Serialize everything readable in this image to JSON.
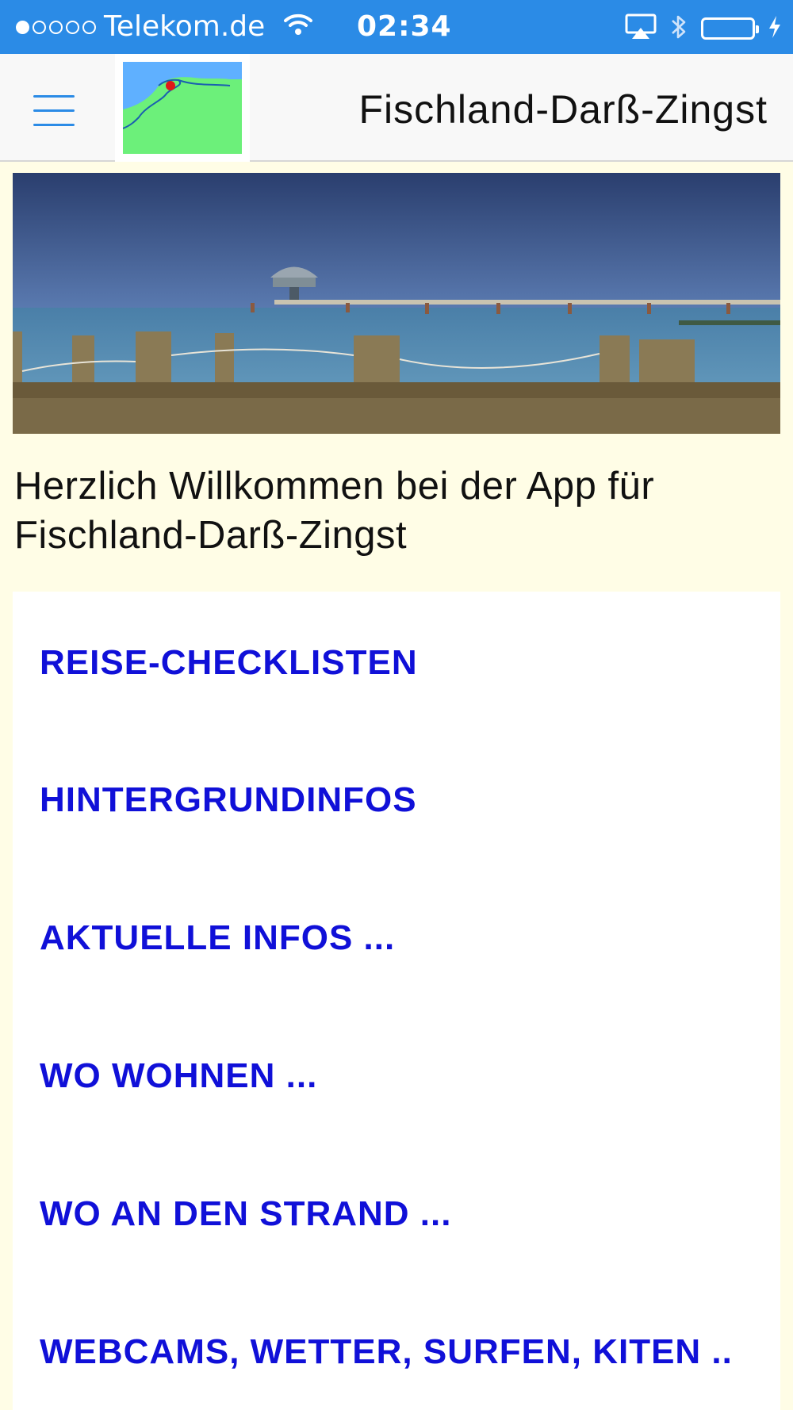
{
  "status_bar": {
    "carrier": "Telekom.de",
    "time": "02:34",
    "signal_bars_on": 1,
    "signal_bars_total": 5,
    "icons": [
      "wifi-icon",
      "airplay-icon",
      "bluetooth-icon",
      "battery-icon",
      "charging-icon"
    ]
  },
  "nav": {
    "title": "Fischland-Darß-Zingst",
    "menu_icon": "hamburger-icon",
    "logo_icon": "map-logo-icon"
  },
  "welcome": {
    "text": "Herzlich Willkommen bei der App für Fischland-Darß-Zingst"
  },
  "menu": {
    "items": [
      {
        "label": "REISE-CHECKLISTEN"
      },
      {
        "label": "HINTERGRUNDINFOS"
      },
      {
        "label": "AKTUELLE INFOS ..."
      },
      {
        "label": "WO WOHNEN ..."
      },
      {
        "label": "WO AN DEN STRAND ..."
      },
      {
        "label": "WEBCAMS, WETTER, SURFEN, KITEN .."
      }
    ]
  },
  "colors": {
    "status_bar": "#2b8be6",
    "accent": "#2b8be6",
    "menu_text": "#1010d8",
    "page_background": "#fffde6"
  }
}
